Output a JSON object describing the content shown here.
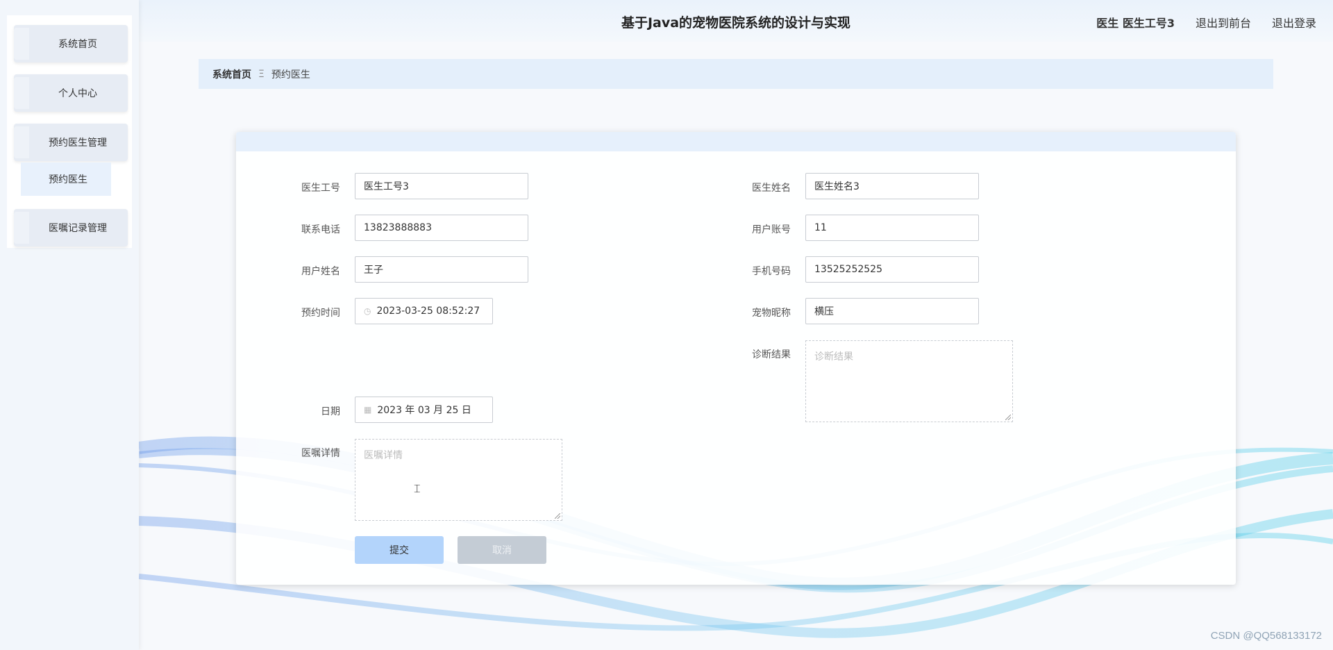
{
  "header": {
    "title": "基于Java的宠物医院系统的设计与实现",
    "user": "医生 医生工号3",
    "back_front": "退出到前台",
    "logout": "退出登录"
  },
  "sidebar": {
    "items": [
      {
        "label": "系统首页"
      },
      {
        "label": "个人中心"
      },
      {
        "label": "预约医生管理"
      },
      {
        "label": "医嘱记录管理"
      }
    ],
    "sub_item": "预约医生"
  },
  "breadcrumb": {
    "home": "系统首页",
    "separator": "Ξ",
    "current": "预约医生"
  },
  "form": {
    "doctor_no": {
      "label": "医生工号",
      "value": "医生工号3"
    },
    "doctor_name": {
      "label": "医生姓名",
      "value": "医生姓名3"
    },
    "phone": {
      "label": "联系电话",
      "value": "13823888883"
    },
    "account": {
      "label": "用户账号",
      "value": "11"
    },
    "user_name": {
      "label": "用户姓名",
      "value": "王子"
    },
    "mobile": {
      "label": "手机号码",
      "value": "13525252525"
    },
    "appt_time": {
      "label": "预约时间",
      "value": "2023-03-25 08:52:27"
    },
    "pet_name": {
      "label": "宠物昵称",
      "value": "横压"
    },
    "diagnosis": {
      "label": "诊断结果",
      "placeholder": "诊断结果"
    },
    "date": {
      "label": "日期",
      "value": "2023 年 03 月 25 日"
    },
    "advice": {
      "label": "医嘱详情",
      "placeholder": "医嘱详情"
    },
    "submit": "提交",
    "cancel": "取消"
  },
  "watermark": "CSDN @QQ568133172"
}
